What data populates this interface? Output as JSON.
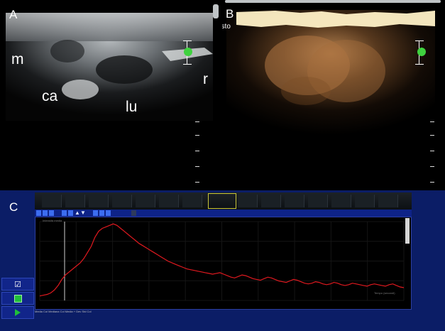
{
  "panels": {
    "a": {
      "letter": "A",
      "labels": {
        "m": "m",
        "ca": "ca",
        "lu": "lu",
        "r": "r"
      }
    },
    "b": {
      "letter": "B",
      "side_label": "asto"
    }
  },
  "bottom": {
    "letter": "C",
    "chart_label_top": "Intensità media",
    "chart_label_right": "Tempo (secondi)",
    "labels_bottom": [
      "Media Col",
      "Mediana Col",
      "Media + Dev Std Col"
    ]
  },
  "chart_data": {
    "type": "line",
    "series": [
      {
        "color": "#e0191f",
        "values": [
          6,
          7,
          8,
          10,
          14,
          20,
          28,
          34,
          38,
          42,
          46,
          50,
          56,
          64,
          72,
          84,
          92,
          96,
          98,
          100,
          102,
          100,
          96,
          92,
          88,
          84,
          80,
          76,
          73,
          70,
          67,
          64,
          61,
          58,
          55,
          52,
          50,
          48,
          46,
          44,
          42,
          41,
          40,
          39,
          38,
          37,
          36,
          35,
          36,
          37,
          35,
          33,
          31,
          30,
          32,
          34,
          33,
          31,
          29,
          28,
          27,
          29,
          31,
          30,
          28,
          26,
          25,
          24,
          26,
          28,
          27,
          25,
          23,
          22,
          23,
          25,
          24,
          22,
          21,
          22,
          24,
          23,
          21,
          20,
          21,
          23,
          22,
          21,
          20,
          19,
          21,
          22,
          21,
          20,
          19,
          21,
          22,
          20,
          18,
          17
        ]
      }
    ]
  }
}
